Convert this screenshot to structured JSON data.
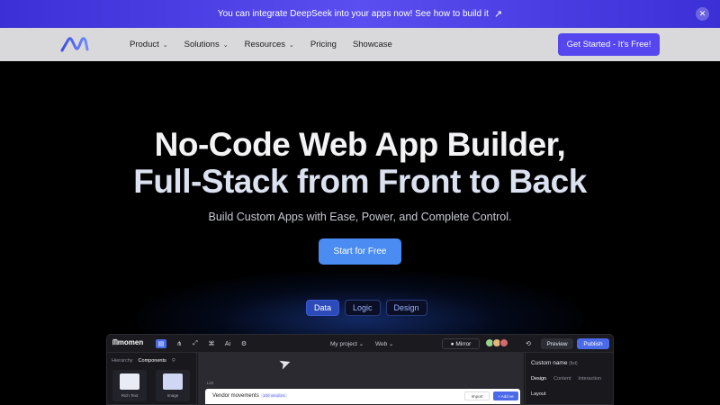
{
  "banner": {
    "text": "You can integrate DeepSeek into your apps now! See how to build it",
    "arrow_icon": "arrow-up-right-icon",
    "close_icon": "close-icon"
  },
  "nav": {
    "logo_icon": "momen-logo-icon",
    "items": [
      {
        "label": "Product",
        "has_dropdown": true
      },
      {
        "label": "Solutions",
        "has_dropdown": true
      },
      {
        "label": "Resources",
        "has_dropdown": true
      },
      {
        "label": "Pricing",
        "has_dropdown": false
      },
      {
        "label": "Showcase",
        "has_dropdown": false
      }
    ],
    "cta_label": "Get Started - It's Free!"
  },
  "hero": {
    "title_line1": "No-Code Web App Builder,",
    "title_line2": "Full-Stack from Front to Back",
    "subtitle": "Build Custom Apps with Ease, Power, and Complete Control.",
    "cta_label": "Start for Free"
  },
  "tabs": [
    {
      "label": "Data",
      "active": true
    },
    {
      "label": "Logic",
      "active": false
    },
    {
      "label": "Design",
      "active": false
    }
  ],
  "app_preview": {
    "brand": "momen",
    "project_label": "My project",
    "platform_label": "Web",
    "mirror_label": "Mirror",
    "preview_label": "Preview",
    "publish_label": "Publish",
    "left_tabs": [
      "Hierarchy",
      "Components"
    ],
    "components": [
      "Rich Text",
      "Image"
    ],
    "canvas": {
      "list_label": "List",
      "card_title": "Vendor movements",
      "card_count": "100 vendors",
      "import_label": "Import",
      "add_label": "+ Add ve"
    },
    "right_panel": {
      "name": "Custom name",
      "name_suffix": "(list)",
      "tabs": [
        "Design",
        "Content",
        "Interaction"
      ],
      "section": "Layout"
    }
  },
  "colors": {
    "accent": "#5546f0",
    "start_button": "#4a8cf2",
    "banner": "#4a3fe8",
    "nav_bg": "#d9d9db"
  }
}
